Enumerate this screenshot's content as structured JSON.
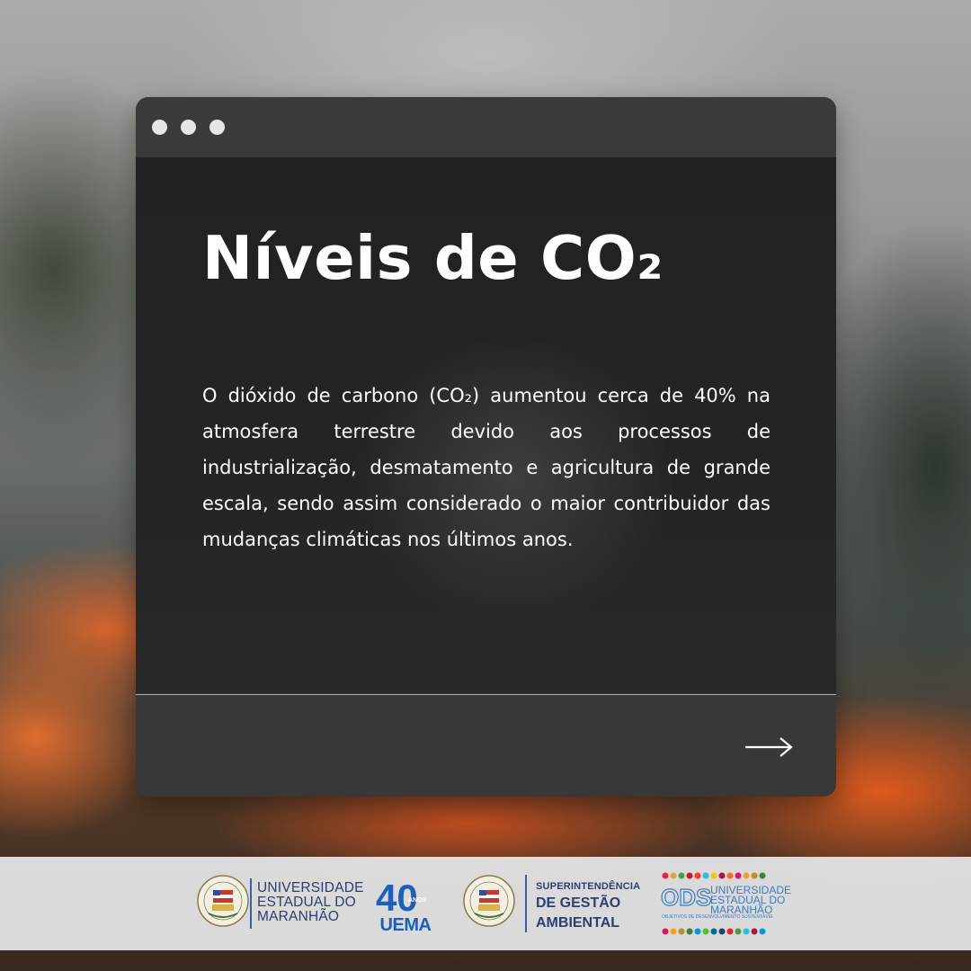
{
  "card": {
    "title": "Níveis de CO₂",
    "body": "O dióxido de carbono (CO₂) aumentou cerca de 40% na atmosfera terrestre devido aos processos de industrialização, desmatamento e agricultura de grande escala, sendo assim considerado o maior contribuidor das mudanças climáticas nos últimos anos."
  },
  "logos": {
    "uema": {
      "line1": "UNIVERSIDADE",
      "line2": "ESTADUAL DO",
      "line3": "MARANHÃO"
    },
    "uema40": {
      "number": "40",
      "small": "ANOS",
      "label": "UEMA"
    },
    "sga": {
      "line1": "SUPERINTENDÊNCIA",
      "line2": "DE GESTÃO",
      "line3": "AMBIENTAL"
    },
    "ods": {
      "mark": "ODS",
      "line1": "UNIVERSIDADE",
      "line2": "ESTADUAL DO",
      "line3": "MARANHÃO",
      "sub": "OBJETIVOS DE DESENVOLVIMENTO SUSTENTÁVEL"
    }
  },
  "colors": {
    "brand_blue": "#2c3f6e",
    "accent_blue": "#1f5fb8",
    "card_header": "#3a3a3a"
  },
  "icons": {
    "next": "arrow-right-icon",
    "window_controls": [
      "window-dot-icon",
      "window-dot-icon",
      "window-dot-icon"
    ]
  }
}
